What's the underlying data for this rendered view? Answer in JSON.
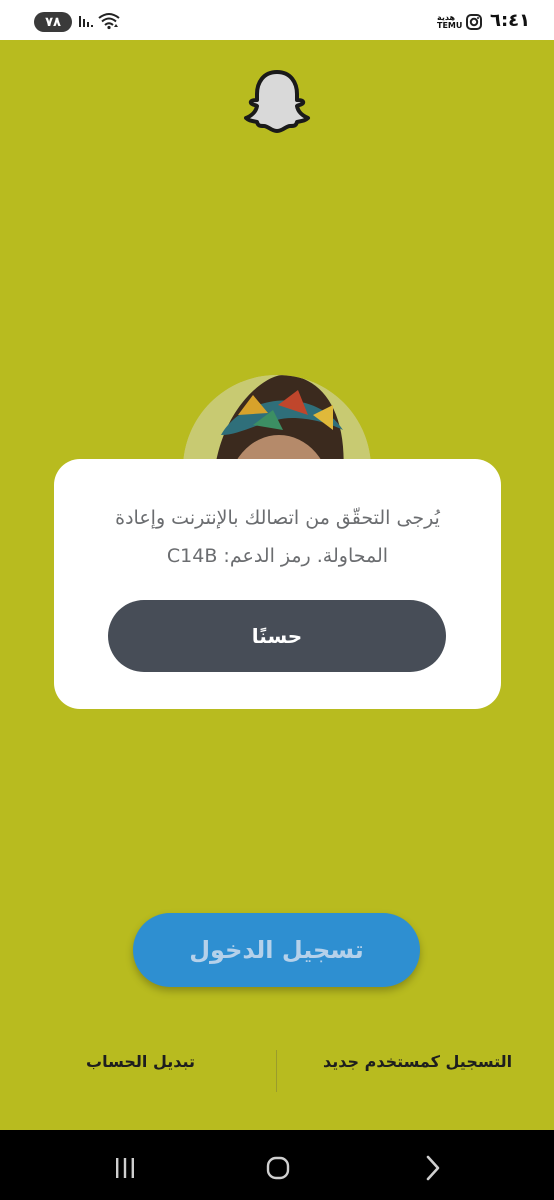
{
  "status_bar": {
    "battery": "٧٨",
    "temu_label_top": "هدية",
    "temu_label_bottom": "TEMU",
    "time": "٦:٤١"
  },
  "dialog": {
    "message": "يُرجى التحقّق من اتصالك بالإنترنت وإعادة المحاولة. رمز الدعم: C14B",
    "ok_label": "حسنًا"
  },
  "login_button_label": "تسجيل الدخول",
  "bottom_links": {
    "signup_label": "التسجيل كمستخدم جديد",
    "switch_account_label": "تبديل الحساب"
  },
  "icons": {
    "app_logo": "snapchat-ghost-icon",
    "nav_recent": "recent-apps-icon",
    "nav_home": "home-icon",
    "nav_back": "back-icon"
  },
  "colors": {
    "background": "#b8bb1f",
    "dialog_button": "#474d57",
    "login_button": "#2e8fd1"
  }
}
